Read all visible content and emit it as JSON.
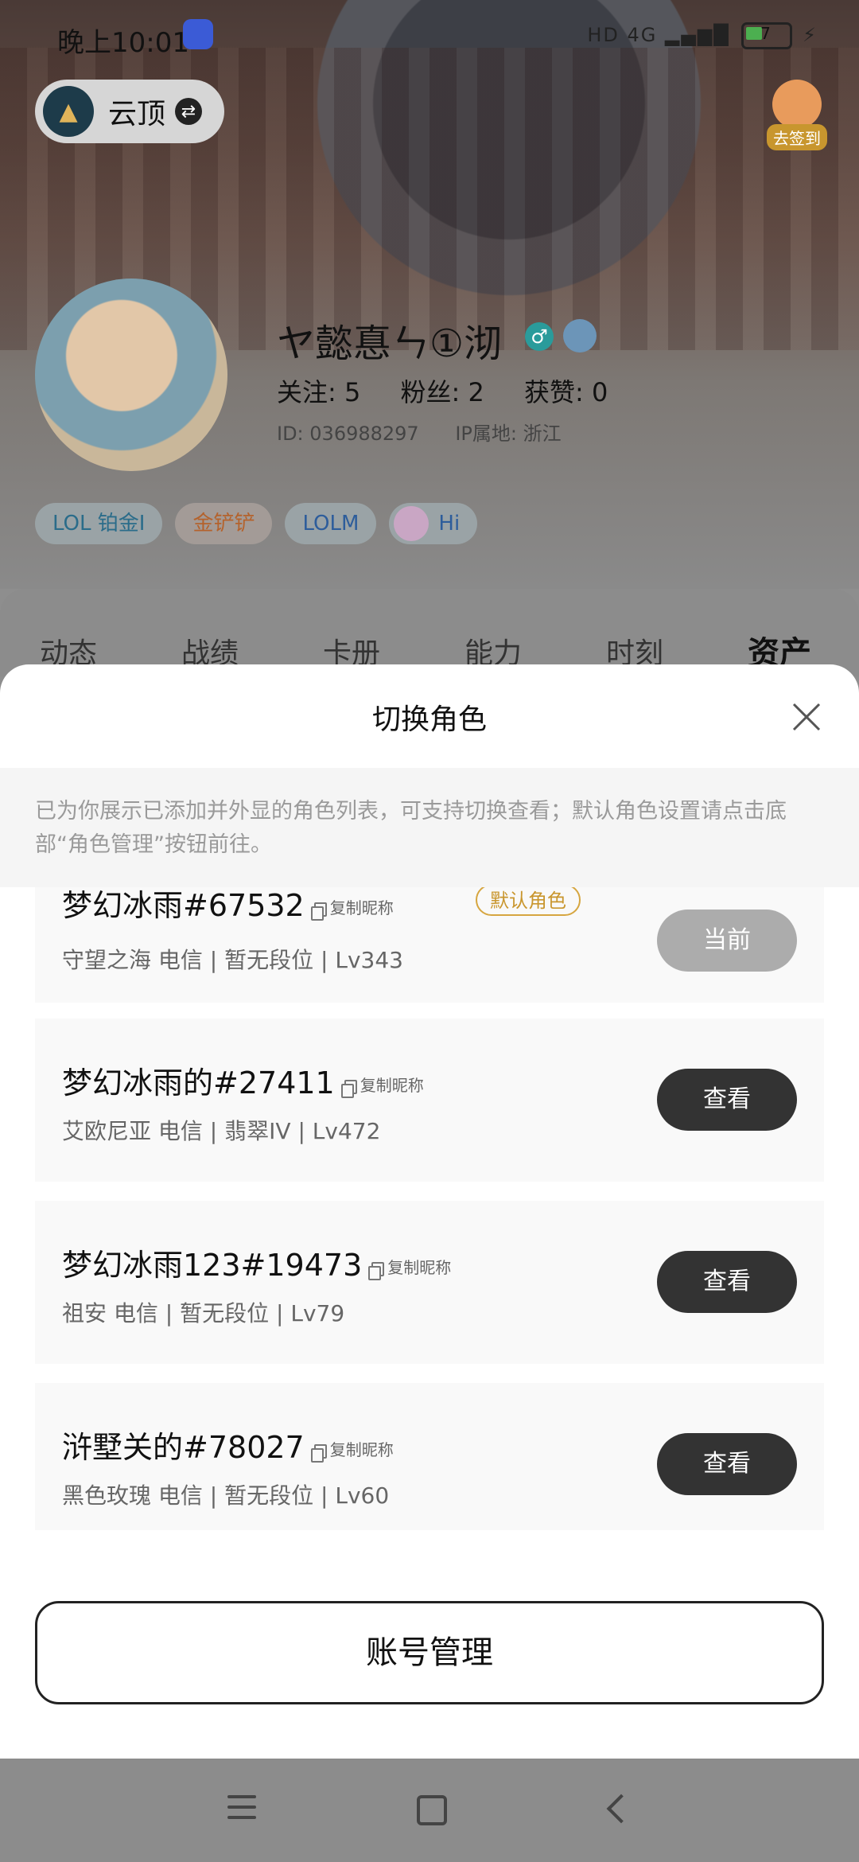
{
  "status_bar": {
    "time": "晚上10:01",
    "hd": "HD",
    "network": "4G",
    "battery_level": "7"
  },
  "header": {
    "game_name": "云顶",
    "signin_label": "去签到"
  },
  "profile": {
    "nickname": "ヤ懿惪ㄣ①沏",
    "follow": "关注: 5",
    "fans": "粉丝: 2",
    "likes": "获赞: 0",
    "id": "ID: 036988297",
    "ip_location": "IP属地: 浙江",
    "chips": [
      "LOL 铂金I",
      "金铲铲",
      "LOLM",
      "Hi"
    ]
  },
  "tabs": [
    "动态",
    "战绩",
    "卡册",
    "能力",
    "时刻",
    "资产"
  ],
  "sheet": {
    "title": "切换角色",
    "notice": "已为你展示已添加并外显的角色列表，可支持切换查看；默认角色设置请点击底部“角色管理”按钮前往。",
    "copy_label": "复制昵称",
    "default_tag": "默认角色",
    "roles": [
      {
        "name": "梦幻冰雨#67532",
        "info": "守望之海 电信 | 暂无段位 | Lv343",
        "button": "当前"
      },
      {
        "name": "梦幻冰雨的#27411",
        "info": "艾欧尼亚  电信 | 翡翠IV | Lv472",
        "button": "查看"
      },
      {
        "name": "梦幻冰雨123#19473",
        "info": "祖安 电信 | 暂无段位 | Lv79",
        "button": "查看"
      },
      {
        "name": "浒墅关的#78027",
        "info": "黑色玫瑰 电信 | 暂无段位 | Lv60",
        "button": "查看"
      }
    ],
    "manage_button": "账号管理"
  }
}
